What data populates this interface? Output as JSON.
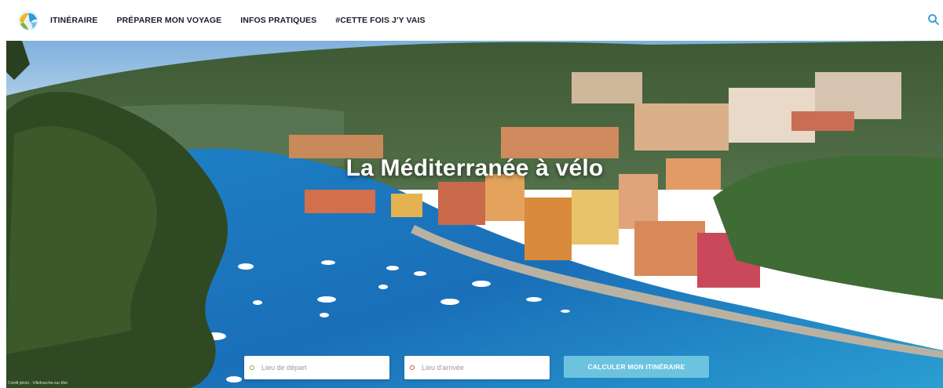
{
  "header": {
    "logo_icon": "cycling-globe-logo",
    "nav": [
      {
        "label": "ITINÉRAIRE"
      },
      {
        "label": "PRÉPARER MON VOYAGE"
      },
      {
        "label": "INFOS PRATIQUES"
      },
      {
        "label": "#CETTE FOIS J'Y VAIS"
      }
    ],
    "search_icon": "search-icon",
    "accent_color": "#2f9bd6"
  },
  "hero": {
    "title": "La Méditerranée à vélo",
    "image": "coastal-village-harbor-photo",
    "credit": "Crédit photo : Villefranche-sur-Mer",
    "form": {
      "departure_placeholder": "Lieu de départ",
      "arrival_placeholder": "Lieu d'arrivée",
      "submit_label": "CALCULER MON ITINÉRAIRE",
      "departure_color": "#7bb244",
      "arrival_color": "#e0474c",
      "button_color": "#6cc3e0"
    }
  }
}
